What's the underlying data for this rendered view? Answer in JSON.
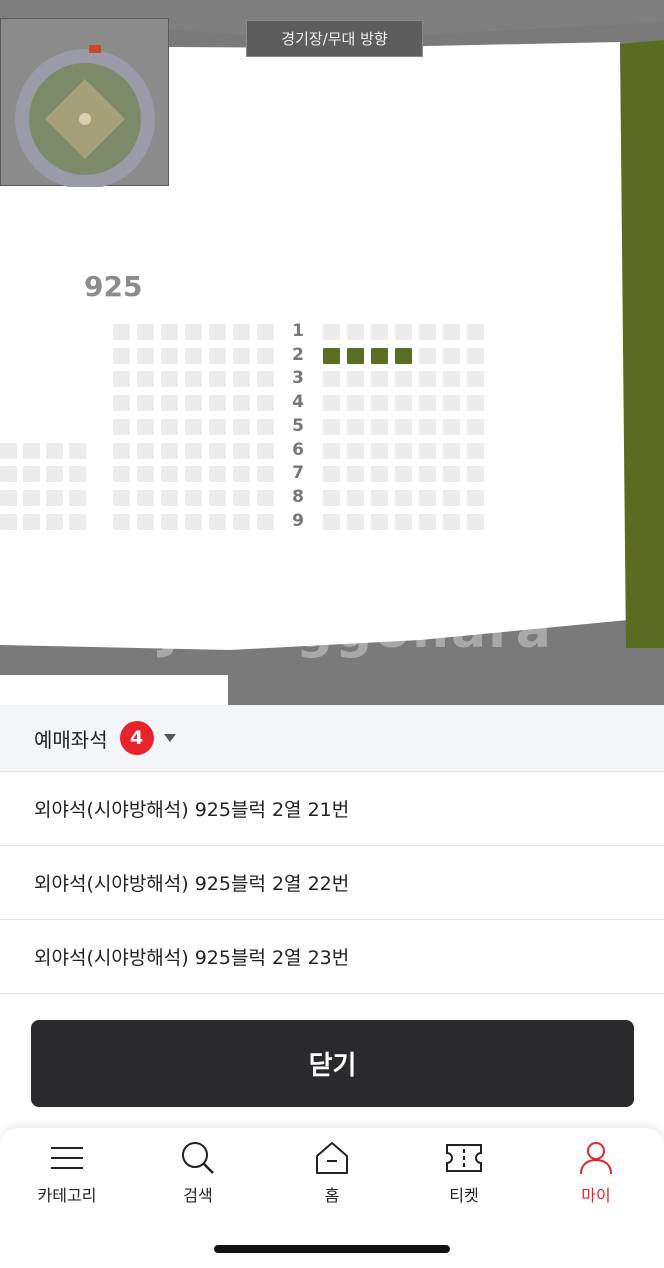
{
  "seat_map": {
    "stage_label": "경기장/무대 방향",
    "block_label": "925",
    "rows": [
      "1",
      "2",
      "3",
      "4",
      "5",
      "6",
      "7",
      "8",
      "9"
    ],
    "selected_seat_color": "#5a6e24"
  },
  "reservation": {
    "title": "예매좌석",
    "count": "4",
    "seats": [
      "외야석(시야방해석) 925블럭 2열 21번",
      "외야석(시야방해석) 925블럭 2열 22번",
      "외야석(시야방해석) 925블럭 2열 23번"
    ]
  },
  "close_button": "닫기",
  "nav": {
    "items": [
      {
        "label": "카테고리",
        "icon": "menu-icon"
      },
      {
        "label": "검색",
        "icon": "search-icon"
      },
      {
        "label": "홈",
        "icon": "home-icon"
      },
      {
        "label": "티켓",
        "icon": "ticket-icon"
      },
      {
        "label": "마이",
        "icon": "user-icon",
        "active": true
      }
    ],
    "active_color": "#e8232a"
  },
  "watermark": "Joonggonara"
}
